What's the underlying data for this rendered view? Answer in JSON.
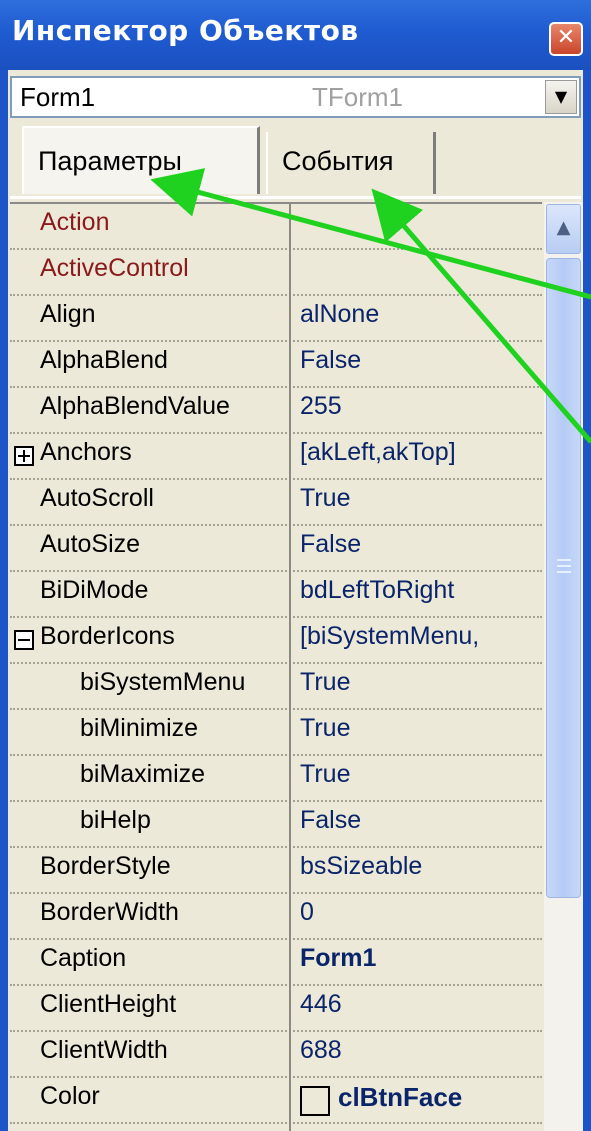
{
  "window": {
    "title": "Инспектор Объектов",
    "close_glyph": "✕"
  },
  "selector": {
    "name": "Form1",
    "type": "TForm1",
    "dropdown_glyph": "▼"
  },
  "tabs": [
    {
      "label": "Параметры",
      "active": true
    },
    {
      "label": "События",
      "active": false
    }
  ],
  "properties": [
    {
      "name": "Action",
      "value": "",
      "color": "red"
    },
    {
      "name": "ActiveControl",
      "value": "",
      "color": "red"
    },
    {
      "name": "Align",
      "value": "alNone"
    },
    {
      "name": "AlphaBlend",
      "value": "False"
    },
    {
      "name": "AlphaBlendValue",
      "value": "255"
    },
    {
      "name": "Anchors",
      "value": "[akLeft,akTop]",
      "expander": "plus"
    },
    {
      "name": "AutoScroll",
      "value": "True"
    },
    {
      "name": "AutoSize",
      "value": "False"
    },
    {
      "name": "BiDiMode",
      "value": "bdLeftToRight"
    },
    {
      "name": "BorderIcons",
      "value": "[biSystemMenu,",
      "expander": "minus"
    },
    {
      "name": "biSystemMenu",
      "value": "True",
      "indent": true
    },
    {
      "name": "biMinimize",
      "value": "True",
      "indent": true
    },
    {
      "name": "biMaximize",
      "value": "True",
      "indent": true
    },
    {
      "name": "biHelp",
      "value": "False",
      "indent": true
    },
    {
      "name": "BorderStyle",
      "value": "bsSizeable"
    },
    {
      "name": "BorderWidth",
      "value": "0"
    },
    {
      "name": "Caption",
      "value": "Form1",
      "bold": true
    },
    {
      "name": "ClientHeight",
      "value": "446"
    },
    {
      "name": "ClientWidth",
      "value": "688"
    },
    {
      "name": "Color",
      "value": "clBtnFace",
      "swatch": true
    }
  ],
  "scrollbar": {
    "up_glyph": "▲"
  },
  "annotation": {
    "arrow_color": "#1fd21f"
  }
}
